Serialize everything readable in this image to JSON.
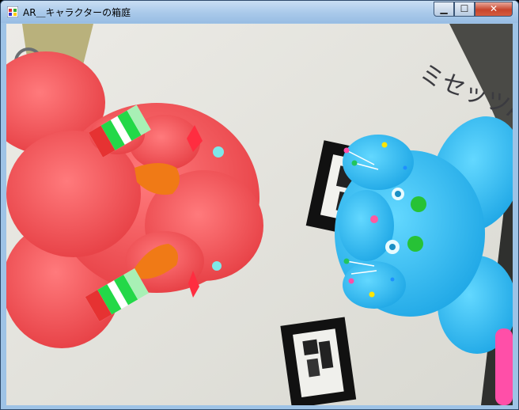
{
  "window": {
    "title": "AR＿キャラクターの箱庭",
    "controls": {
      "minimize": "▁",
      "maximize": "☐",
      "close": "✕"
    }
  },
  "camera": {
    "poster_text": "ミセッツAR"
  },
  "colors": {
    "red_character": "#f15a5c",
    "blue_character": "#33c4f5",
    "carrot": "#f07a16",
    "pink_leg": "#ff4fa8",
    "marker_black": "#111111"
  }
}
